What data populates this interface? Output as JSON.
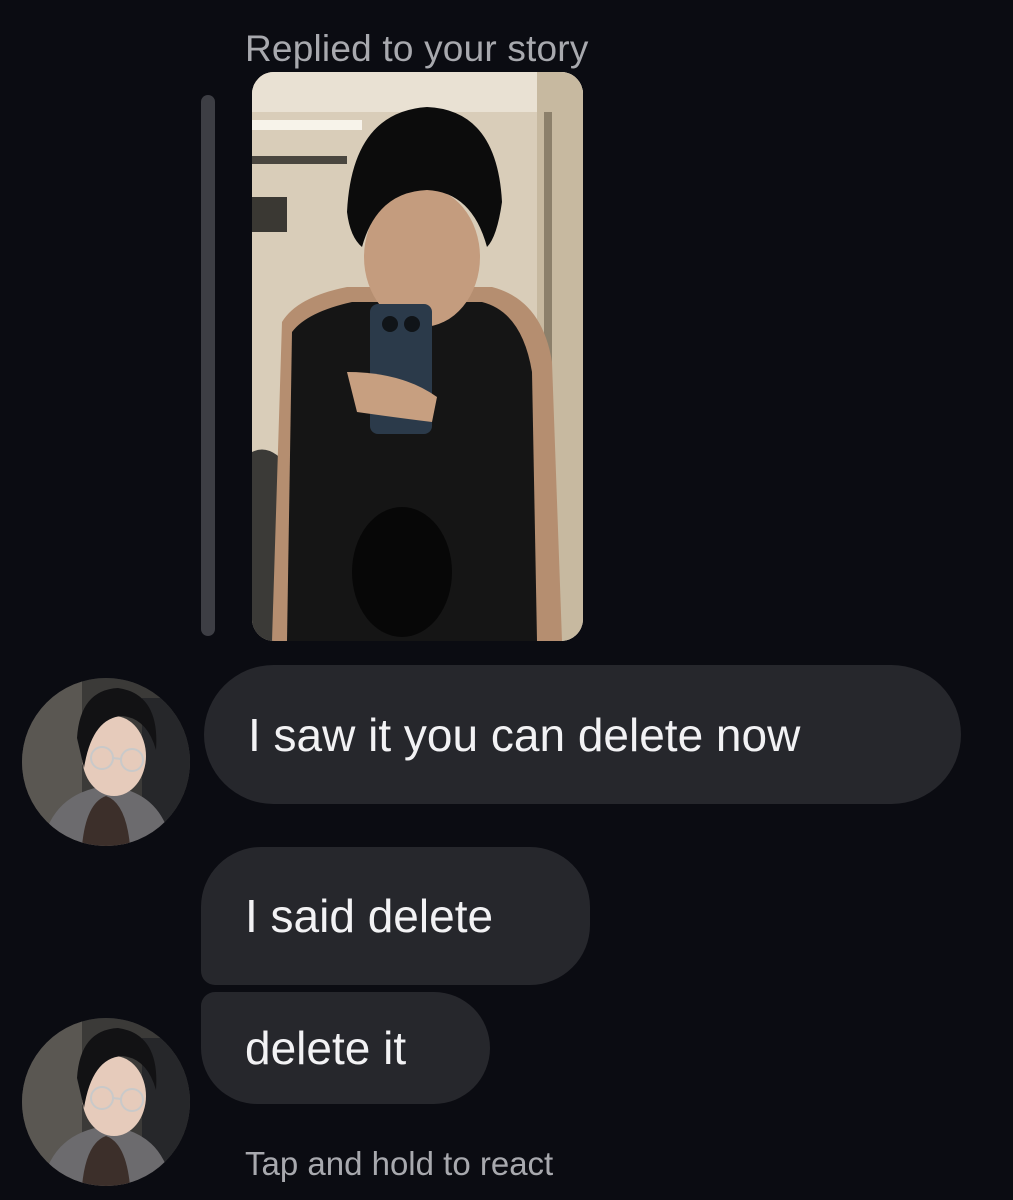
{
  "thread": {
    "reply_label": "Replied to your story",
    "messages": [
      {
        "text": "I saw it you can delete now"
      },
      {
        "text": "I said delete"
      },
      {
        "text": "delete it"
      }
    ],
    "react_hint": "Tap and hold to react"
  },
  "icons": {
    "avatar": "profile-photo",
    "story": "story-thumbnail-photo"
  },
  "colors": {
    "background": "#0b0c12",
    "bubble": "#26272c",
    "secondary_text": "#a8a9ae",
    "primary_text": "#f2f2f4"
  }
}
